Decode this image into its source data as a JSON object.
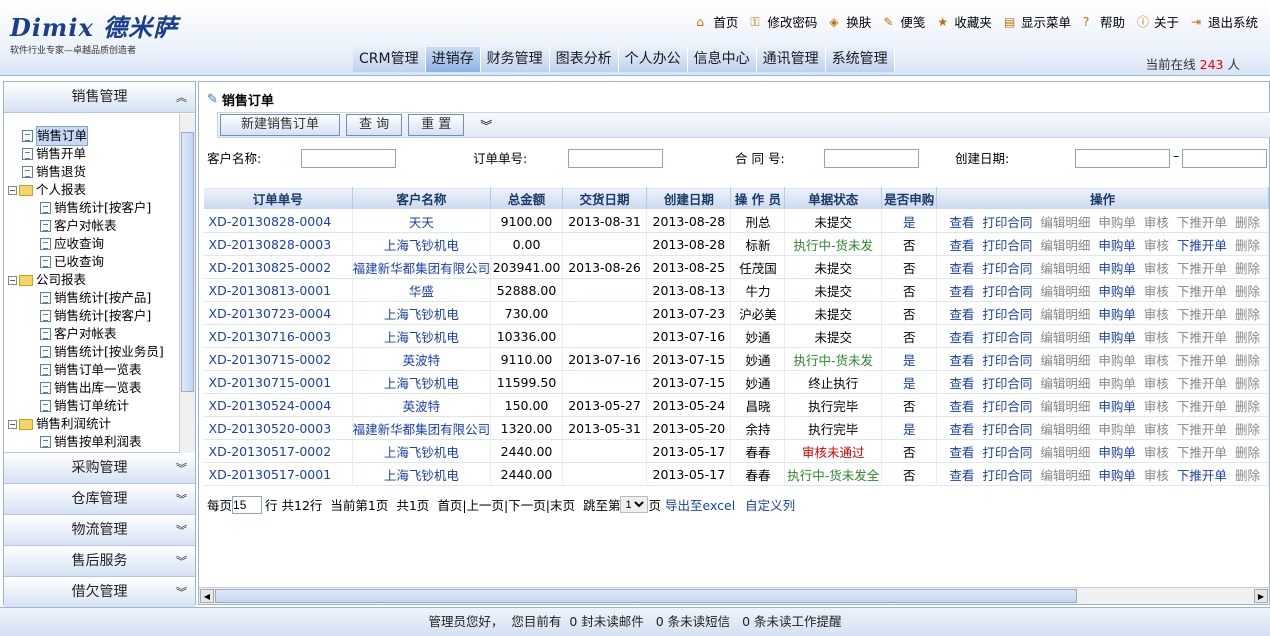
{
  "header": {
    "logo_text": "Dimix 德米萨",
    "logo_sub": "软件行业专家—卓越品质创造者",
    "links": [
      {
        "icon": "home-icon",
        "label": "首页"
      },
      {
        "icon": "key-icon",
        "label": "修改密码"
      },
      {
        "icon": "palette-icon",
        "label": "换肤"
      },
      {
        "icon": "notepad-icon",
        "label": "便笺"
      },
      {
        "icon": "star-icon",
        "label": "收藏夹"
      },
      {
        "icon": "menu-icon",
        "label": "显示菜单"
      },
      {
        "icon": "help-icon",
        "label": "帮助"
      },
      {
        "icon": "info-icon",
        "label": "关于"
      },
      {
        "icon": "exit-icon",
        "label": "退出系统"
      }
    ],
    "tabs": [
      "CRM管理",
      "进销存",
      "财务管理",
      "图表分析",
      "个人办公",
      "信息中心",
      "通讯管理",
      "系统管理"
    ],
    "online_prefix": "当前在线",
    "online_count": "243",
    "online_suffix": "人"
  },
  "sidebar": {
    "open_section": "销售管理",
    "tree": [
      {
        "label": "销售订单",
        "level": 1,
        "type": "doc",
        "selected": true
      },
      {
        "label": "销售开单",
        "level": 1,
        "type": "doc"
      },
      {
        "label": "销售退货",
        "level": 1,
        "type": "doc"
      },
      {
        "label": "个人报表",
        "level": 0,
        "type": "folder"
      },
      {
        "label": "销售统计[按客户]",
        "level": 2,
        "type": "doc"
      },
      {
        "label": "客户对帐表",
        "level": 2,
        "type": "doc"
      },
      {
        "label": "应收查询",
        "level": 2,
        "type": "doc"
      },
      {
        "label": "已收查询",
        "level": 2,
        "type": "doc"
      },
      {
        "label": "公司报表",
        "level": 0,
        "type": "folder"
      },
      {
        "label": "销售统计[按产品]",
        "level": 2,
        "type": "doc"
      },
      {
        "label": "销售统计[按客户]",
        "level": 2,
        "type": "doc"
      },
      {
        "label": "客户对帐表",
        "level": 2,
        "type": "doc"
      },
      {
        "label": "销售统计[按业务员]",
        "level": 2,
        "type": "doc"
      },
      {
        "label": "销售订单一览表",
        "level": 2,
        "type": "doc"
      },
      {
        "label": "销售出库一览表",
        "level": 2,
        "type": "doc"
      },
      {
        "label": "销售订单统计",
        "level": 2,
        "type": "doc"
      },
      {
        "label": "销售利润统计",
        "level": 0,
        "type": "folder"
      },
      {
        "label": "销售按单利润表",
        "level": 2,
        "type": "doc"
      }
    ],
    "sections": [
      "采购管理",
      "仓库管理",
      "物流管理",
      "售后服务",
      "借欠管理"
    ]
  },
  "main": {
    "title": "销售订单",
    "buttons": {
      "new": "新建销售订单",
      "query": "查 询",
      "reset": "重 置"
    },
    "filters": {
      "customer": "客户名称:",
      "order_no": "订单单号:",
      "contract": "合 同 号:",
      "created": "创建日期:",
      "dash": "–"
    },
    "columns": [
      "订单单号",
      "客户名称",
      "总金额",
      "交货日期",
      "创建日期",
      "操 作 员",
      "单据状态",
      "是否申购",
      "操作"
    ],
    "rows": [
      {
        "no": "XD-20130828-0004",
        "cust": "天天",
        "amt": "9100.00",
        "deliv": "2013-08-31",
        "created": "2013-08-28",
        "op": "刑总",
        "status": "未提交",
        "st": "n",
        "pur": "是",
        "req": false,
        "push": false
      },
      {
        "no": "XD-20130828-0003",
        "cust": "上海飞钞机电",
        "amt": "0.00",
        "deliv": "",
        "created": "2013-08-28",
        "op": "标新",
        "status": "执行中-货未发",
        "st": "g",
        "pur": "否",
        "req": true,
        "push": true
      },
      {
        "no": "XD-20130825-0002",
        "cust": "福建新华都集团有限公司",
        "amt": "203941.00",
        "deliv": "2013-08-26",
        "created": "2013-08-25",
        "op": "任茂国",
        "status": "未提交",
        "st": "n",
        "pur": "否",
        "req": true,
        "push": false
      },
      {
        "no": "XD-20130813-0001",
        "cust": "华盛",
        "amt": "52888.00",
        "deliv": "",
        "created": "2013-08-13",
        "op": "牛力",
        "status": "未提交",
        "st": "n",
        "pur": "否",
        "req": true,
        "push": false
      },
      {
        "no": "XD-20130723-0004",
        "cust": "上海飞钞机电",
        "amt": "730.00",
        "deliv": "",
        "created": "2013-07-23",
        "op": "沪必美",
        "status": "未提交",
        "st": "n",
        "pur": "否",
        "req": true,
        "push": false
      },
      {
        "no": "XD-20130716-0003",
        "cust": "上海飞钞机电",
        "amt": "10336.00",
        "deliv": "",
        "created": "2013-07-16",
        "op": "妙通",
        "status": "未提交",
        "st": "n",
        "pur": "否",
        "req": true,
        "push": false
      },
      {
        "no": "XD-20130715-0002",
        "cust": "英波特",
        "amt": "9110.00",
        "deliv": "2013-07-16",
        "created": "2013-07-15",
        "op": "妙通",
        "status": "执行中-货未发",
        "st": "g",
        "pur": "是",
        "req": false,
        "push": false
      },
      {
        "no": "XD-20130715-0001",
        "cust": "上海飞钞机电",
        "amt": "11599.50",
        "deliv": "",
        "created": "2013-07-15",
        "op": "妙通",
        "status": "终止执行",
        "st": "n",
        "pur": "是",
        "req": false,
        "push": false
      },
      {
        "no": "XD-20130524-0004",
        "cust": "英波特",
        "amt": "150.00",
        "deliv": "2013-05-27",
        "created": "2013-05-24",
        "op": "昌晓",
        "status": "执行完毕",
        "st": "n",
        "pur": "否",
        "req": true,
        "push": false
      },
      {
        "no": "XD-20130520-0003",
        "cust": "福建新华都集团有限公司",
        "amt": "1320.00",
        "deliv": "2013-05-31",
        "created": "2013-05-20",
        "op": "余持",
        "status": "执行完毕",
        "st": "n",
        "pur": "是",
        "req": false,
        "push": false
      },
      {
        "no": "XD-20130517-0002",
        "cust": "上海飞钞机电",
        "amt": "2440.00",
        "deliv": "",
        "created": "2013-05-17",
        "op": "春春",
        "status": "审核未通过",
        "st": "r",
        "pur": "否",
        "req": true,
        "push": false
      },
      {
        "no": "XD-20130517-0001",
        "cust": "上海飞钞机电",
        "amt": "2440.00",
        "deliv": "",
        "created": "2013-05-17",
        "op": "春春",
        "status": "执行中-货未发全",
        "st": "g",
        "pur": "否",
        "req": true,
        "push": true
      }
    ],
    "ops": [
      "查看",
      "打印合同",
      "编辑明细",
      "申购单",
      "审核",
      "下推开单",
      "删除"
    ],
    "pager": {
      "per_prefix": "每页",
      "per": "15",
      "per_suffix": "行 共12行",
      "current": "当前第1页",
      "total": "共1页",
      "nav": "首页|上一页|下一页|末页",
      "jump_prefix": "跳至第",
      "jump_value": "1",
      "jump_suffix": "页",
      "export": "导出至excel",
      "custom": "自定义列"
    }
  },
  "footer": {
    "text": "管理员您好，  您目前有  0 封未读邮件   0 条未读短信   0 条未读工作提醒"
  }
}
